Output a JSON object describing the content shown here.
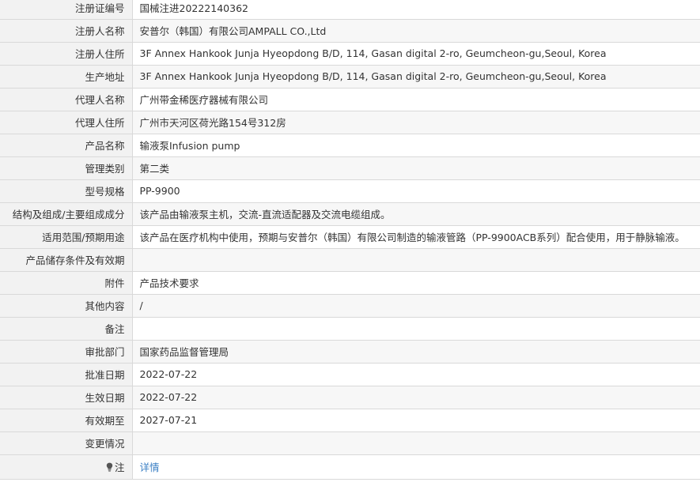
{
  "rows": [
    {
      "label": "注册证编号",
      "value": "国械注进20222140362"
    },
    {
      "label": "注册人名称",
      "value": "安普尔（韩国）有限公司AMPALL CO.,Ltd"
    },
    {
      "label": "注册人住所",
      "value": "3F Annex Hankook Junja Hyeopdong B/D, 114, Gasan digital 2-ro, Geumcheon-gu,Seoul, Korea"
    },
    {
      "label": "生产地址",
      "value": "3F Annex Hankook Junja Hyeopdong B/D, 114, Gasan digital 2-ro, Geumcheon-gu,Seoul, Korea"
    },
    {
      "label": "代理人名称",
      "value": "广州带金稀医疗器械有限公司"
    },
    {
      "label": "代理人住所",
      "value": "广州市天河区荷光路154号312房"
    },
    {
      "label": "产品名称",
      "value": "输液泵Infusion pump"
    },
    {
      "label": "管理类别",
      "value": "第二类"
    },
    {
      "label": "型号规格",
      "value": "PP-9900"
    },
    {
      "label": "结构及组成/主要组成成分",
      "value": "该产品由输液泵主机，交流-直流适配器及交流电缆组成。"
    },
    {
      "label": "适用范围/预期用途",
      "value": "该产品在医疗机构中使用，预期与安普尔（韩国）有限公司制造的输液管路（PP-9900ACB系列）配合使用，用于静脉输液。"
    },
    {
      "label": "产品储存条件及有效期",
      "value": ""
    },
    {
      "label": "附件",
      "value": "产品技术要求"
    },
    {
      "label": "其他内容",
      "value": "/"
    },
    {
      "label": "备注",
      "value": ""
    },
    {
      "label": "审批部门",
      "value": "国家药品监督管理局"
    },
    {
      "label": "批准日期",
      "value": "2022-07-22"
    },
    {
      "label": "生效日期",
      "value": "2022-07-22"
    },
    {
      "label": "有效期至",
      "value": "2027-07-21"
    },
    {
      "label": "变更情况",
      "value": ""
    }
  ],
  "note": {
    "label": "注",
    "icon": "lightbulb-icon",
    "link_text": "详情",
    "link_color": "#3a7fc4"
  }
}
